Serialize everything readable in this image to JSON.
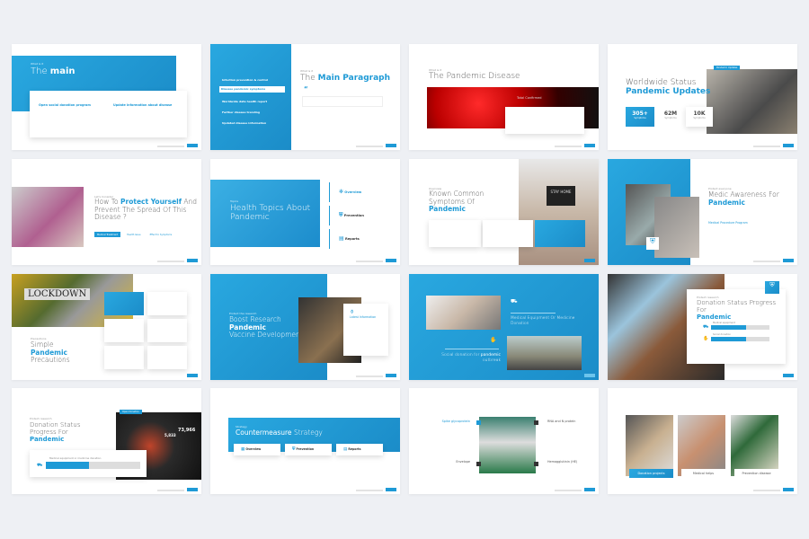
{
  "accent": "#1e9ad6",
  "s1": {
    "label": "What is it",
    "title_a": "The ",
    "title_b": "main",
    "c1": "Open social donation program",
    "c2": "Update information about disease"
  },
  "s2": {
    "menu": [
      "Infection prevention & control",
      "Disease pandemic symptoms",
      "Worldwide data health report",
      "Further disease trending",
      "Updated disease information"
    ],
    "label": "What is it",
    "title_a": "The ",
    "title_b": "Main Paragraph",
    "quote": "“"
  },
  "s3": {
    "label": "What is it",
    "title": "The Pandemic Disease",
    "overlay": "Total Confirmed"
  },
  "s4": {
    "badge": "Pandemic Updates",
    "title_a": "Worldwide Status",
    "title_b": "Pandemic Updates",
    "stats": [
      {
        "v": "305+",
        "l": "Symptoms"
      },
      {
        "v": "62M",
        "l": "Symptoms"
      },
      {
        "v": "10K",
        "l": "Symptoms"
      }
    ]
  },
  "s5": {
    "label": "Let's Consider",
    "t1": "How To ",
    "t2": "Protect Yourself",
    "t3": "And Prevent The Spread Of This Disease ?",
    "buttons": [
      "Medical Treatment",
      "Health Issue",
      "Effect to Symptoms"
    ]
  },
  "s6": {
    "label": "Topics",
    "title": "Health Topics About Pandemic",
    "items": [
      "Overview",
      "Prevention",
      "Reports"
    ]
  },
  "s7": {
    "label": "Overview",
    "t1": "Known Common Symptoms Of",
    "t2": "Pandemic",
    "sign": "STAY HOME"
  },
  "s8": {
    "label": "Protect everyone",
    "t1": "Medic Awareness For ",
    "t2": "Pandemic",
    "sub": "Medical Procedure Program"
  },
  "s9": {
    "sign": "LOCKDOWN",
    "label": "Precautions",
    "t1": "Simple",
    "t2": "Pandemic",
    "t3": "Precautions"
  },
  "s10": {
    "label": "Protect the research",
    "t1": "Boost Research",
    "t2": "Pandemic",
    "t3": "Vaccine Development",
    "card": "Latest Information"
  },
  "s11": {
    "t1": "Medical Equipment Or Medicine Donation",
    "t2": "Social donation for ",
    "t3": "pandemic",
    "t4": " outbreak"
  },
  "s12": {
    "label": "Protect research",
    "t1": "Donation Status Progress For",
    "t2": "Pandemic",
    "rows": [
      {
        "l": "Medical equipment",
        "p": 0.6
      },
      {
        "l": "Social donation",
        "p": 0.6
      }
    ]
  },
  "s13": {
    "label": "Protect research",
    "badge": "Open Donation",
    "t1": "Donation Status Progress For",
    "t2": "Pandemic",
    "n1": "5,833",
    "n2": "73,966",
    "row": "Medical equipment or medicine donation",
    "p": 0.45
  },
  "s14": {
    "label": "Strategy",
    "t1": "Countermeasure",
    "t2": " Strategy",
    "items": [
      "Overview",
      "Prevention",
      "Reports"
    ]
  },
  "s15": {
    "items": [
      "Spike glycoprotein",
      "Envelope",
      "RNA and N protein",
      "Hemagglutinin (HE)"
    ]
  },
  "s16": {
    "captions": [
      "Donation projects",
      "Medical helps",
      "Prevention disease"
    ]
  }
}
